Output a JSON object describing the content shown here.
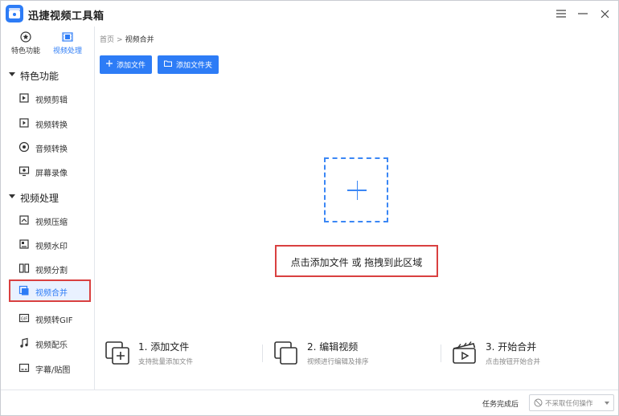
{
  "app": {
    "title": "迅捷视频工具箱",
    "icon": "video-toolbox-logo"
  },
  "window_controls": {
    "menu": "hamburger-icon",
    "minimize": "minimize-icon",
    "close": "close-icon"
  },
  "top_nav": [
    {
      "label": "特色功能",
      "icon": "star-circle-icon",
      "active": false
    },
    {
      "label": "视频处理",
      "icon": "film-icon",
      "active": true
    }
  ],
  "sidebar": {
    "groups": [
      {
        "label": "特色功能",
        "items": [
          {
            "label": "视频剪辑",
            "icon": "video-edit-icon"
          },
          {
            "label": "视频转换",
            "icon": "video-convert-icon"
          },
          {
            "label": "音频转换",
            "icon": "audio-convert-icon"
          },
          {
            "label": "屏幕录像",
            "icon": "screen-record-icon"
          }
        ]
      },
      {
        "label": "视频处理",
        "items": [
          {
            "label": "视频压缩",
            "icon": "video-compress-icon"
          },
          {
            "label": "视频水印",
            "icon": "video-watermark-icon"
          },
          {
            "label": "视频分割",
            "icon": "video-split-icon"
          },
          {
            "label": "视频合并",
            "icon": "video-merge-icon",
            "active": true
          },
          {
            "label": "视频转GIF",
            "icon": "gif-icon"
          },
          {
            "label": "视频配乐",
            "icon": "music-note-icon"
          },
          {
            "label": "字幕/贴图",
            "icon": "subtitle-sticker-icon"
          }
        ]
      }
    ]
  },
  "breadcrumb": {
    "home": "首页",
    "separator": ">",
    "current": "视频合并"
  },
  "toolbar": {
    "add_file": "添加文件",
    "add_folder": "添加文件夹"
  },
  "drop_zone": {
    "hint": "点击添加文件 或 拖拽到此区域"
  },
  "steps": [
    {
      "title": "1. 添加文件",
      "desc": "支持批量添加文件",
      "icon": "add-file-icon"
    },
    {
      "title": "2. 编辑视频",
      "desc": "视频进行编辑及排序",
      "icon": "edit-video-icon"
    },
    {
      "title": "3. 开始合并",
      "desc": "点击按钮开始合并",
      "icon": "clapperboard-icon"
    }
  ],
  "footer": {
    "after_task_label": "任务完成后",
    "after_task_value": "不采取任何操作"
  },
  "colors": {
    "accent": "#2d7cf6",
    "highlight_border": "#d94040",
    "active_bg": "#e9f1ff"
  }
}
